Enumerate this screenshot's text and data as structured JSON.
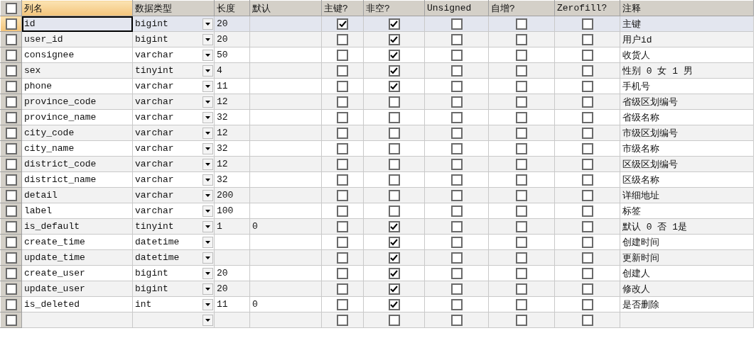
{
  "select_all": {
    "checked": false
  },
  "columns": [
    {
      "label": "列名",
      "selected": true
    },
    {
      "label": "数据类型",
      "selected": false
    },
    {
      "label": "长度",
      "selected": false
    },
    {
      "label": "默认",
      "selected": false
    },
    {
      "label": "主键?",
      "selected": false
    },
    {
      "label": "非空?",
      "selected": false
    },
    {
      "label": "Unsigned",
      "selected": false
    },
    {
      "label": "自增?",
      "selected": false
    },
    {
      "label": "Zerofill?",
      "selected": false
    },
    {
      "label": "注释",
      "selected": false
    }
  ],
  "rows": [
    {
      "name": "id",
      "type": "bigint",
      "length": "20",
      "primary_key": true,
      "not_null": true,
      "unsigned": false,
      "auto_increment": false,
      "zerofill": false,
      "comment": "主键",
      "selected": true
    },
    {
      "name": "user_id",
      "type": "bigint",
      "length": "20",
      "primary_key": false,
      "not_null": true,
      "unsigned": false,
      "auto_increment": false,
      "zerofill": false,
      "comment": "用户id",
      "selected": false
    },
    {
      "name": "consignee",
      "type": "varchar",
      "length": "50",
      "primary_key": false,
      "not_null": true,
      "unsigned": false,
      "auto_increment": false,
      "zerofill": false,
      "comment": "收货人",
      "selected": false
    },
    {
      "name": "sex",
      "type": "tinyint",
      "length": "4",
      "primary_key": false,
      "not_null": true,
      "unsigned": false,
      "auto_increment": false,
      "zerofill": false,
      "comment": "性别 0 女 1 男",
      "selected": false
    },
    {
      "name": "phone",
      "type": "varchar",
      "length": "11",
      "primary_key": false,
      "not_null": true,
      "unsigned": false,
      "auto_increment": false,
      "zerofill": false,
      "comment": "手机号",
      "selected": false
    },
    {
      "name": "province_code",
      "type": "varchar",
      "length": "12",
      "primary_key": false,
      "not_null": false,
      "unsigned": false,
      "auto_increment": false,
      "zerofill": false,
      "comment": "省级区划编号",
      "selected": false
    },
    {
      "name": "province_name",
      "type": "varchar",
      "length": "32",
      "primary_key": false,
      "not_null": false,
      "unsigned": false,
      "auto_increment": false,
      "zerofill": false,
      "comment": "省级名称",
      "selected": false
    },
    {
      "name": "city_code",
      "type": "varchar",
      "length": "12",
      "primary_key": false,
      "not_null": false,
      "unsigned": false,
      "auto_increment": false,
      "zerofill": false,
      "comment": "市级区划编号",
      "selected": false
    },
    {
      "name": "city_name",
      "type": "varchar",
      "length": "32",
      "primary_key": false,
      "not_null": false,
      "unsigned": false,
      "auto_increment": false,
      "zerofill": false,
      "comment": "市级名称",
      "selected": false
    },
    {
      "name": "district_code",
      "type": "varchar",
      "length": "12",
      "primary_key": false,
      "not_null": false,
      "unsigned": false,
      "auto_increment": false,
      "zerofill": false,
      "comment": "区级区划编号",
      "selected": false
    },
    {
      "name": "district_name",
      "type": "varchar",
      "length": "32",
      "primary_key": false,
      "not_null": false,
      "unsigned": false,
      "auto_increment": false,
      "zerofill": false,
      "comment": "区级名称",
      "selected": false
    },
    {
      "name": "detail",
      "type": "varchar",
      "length": "200",
      "primary_key": false,
      "not_null": false,
      "unsigned": false,
      "auto_increment": false,
      "zerofill": false,
      "comment": "详细地址",
      "selected": false
    },
    {
      "name": "label",
      "type": "varchar",
      "length": "100",
      "primary_key": false,
      "not_null": false,
      "unsigned": false,
      "auto_increment": false,
      "zerofill": false,
      "comment": "标签",
      "selected": false
    },
    {
      "name": "is_default",
      "type": "tinyint",
      "length": "1",
      "default": "0",
      "primary_key": false,
      "not_null": true,
      "unsigned": false,
      "auto_increment": false,
      "zerofill": false,
      "comment": "默认 0 否 1是",
      "selected": false
    },
    {
      "name": "create_time",
      "type": "datetime",
      "primary_key": false,
      "not_null": true,
      "unsigned": false,
      "auto_increment": false,
      "zerofill": false,
      "comment": "创建时间",
      "selected": false
    },
    {
      "name": "update_time",
      "type": "datetime",
      "primary_key": false,
      "not_null": true,
      "unsigned": false,
      "auto_increment": false,
      "zerofill": false,
      "comment": "更新时间",
      "selected": false
    },
    {
      "name": "create_user",
      "type": "bigint",
      "length": "20",
      "primary_key": false,
      "not_null": true,
      "unsigned": false,
      "auto_increment": false,
      "zerofill": false,
      "comment": "创建人",
      "selected": false
    },
    {
      "name": "update_user",
      "type": "bigint",
      "length": "20",
      "primary_key": false,
      "not_null": true,
      "unsigned": false,
      "auto_increment": false,
      "zerofill": false,
      "comment": "修改人",
      "selected": false
    },
    {
      "name": "is_deleted",
      "type": "int",
      "length": "11",
      "default": "0",
      "primary_key": false,
      "not_null": true,
      "unsigned": false,
      "auto_increment": false,
      "zerofill": false,
      "comment": "是否删除",
      "selected": false
    },
    {
      "primary_key": false,
      "not_null": false,
      "unsigned": false,
      "auto_increment": false,
      "zerofill": false,
      "selected": false
    }
  ]
}
